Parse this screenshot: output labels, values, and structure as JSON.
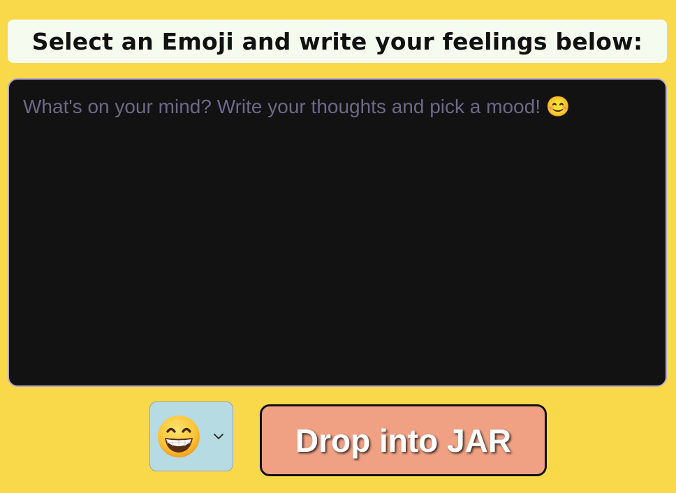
{
  "heading": {
    "text": "Select an Emoji and write your feelings below:"
  },
  "journal": {
    "value": "",
    "placeholder": "What's on your mind? Write your thoughts and pick a mood! 😊"
  },
  "mood_select": {
    "selected_icon": "grinning-face-with-smiling-eyes-emoji"
  },
  "drop_button": {
    "label": "Drop into JAR"
  },
  "colors": {
    "page_background": "#f9d84a",
    "heading_background": "#f5fbef",
    "textarea_background": "#121212",
    "placeholder": "#6e6888",
    "select_background": "#b7dbe3",
    "button_background": "#f0a184"
  }
}
